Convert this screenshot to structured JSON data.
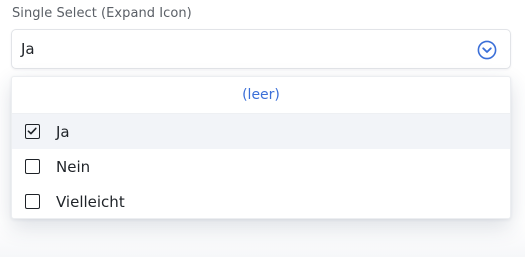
{
  "field": {
    "label": "Single Select (Expand Icon)",
    "selected_value": "Ja",
    "expand_icon": "chevron-down-circle-icon"
  },
  "dropdown": {
    "empty_option": "(leer)",
    "options": [
      {
        "label": "Ja",
        "checked": true
      },
      {
        "label": "Nein",
        "checked": false
      },
      {
        "label": "Vielleicht",
        "checked": false
      }
    ]
  },
  "colors": {
    "accent": "#3b6fd8",
    "highlight_row": "#f2f4f8",
    "text": "#1f2328",
    "label_text": "#5a5f66"
  }
}
